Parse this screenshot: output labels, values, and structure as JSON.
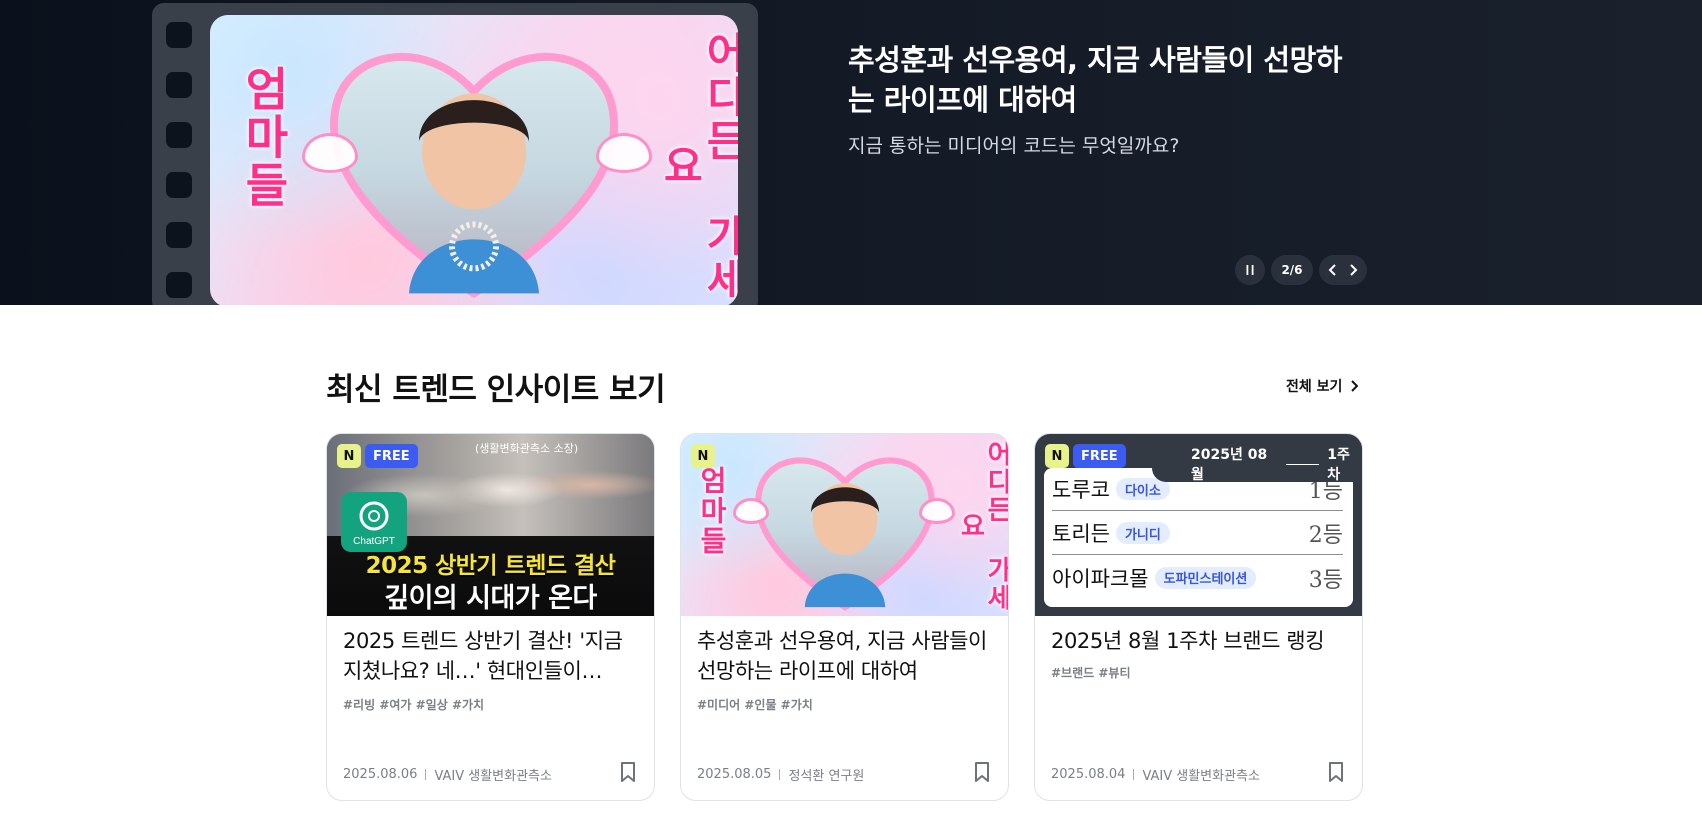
{
  "hero": {
    "title": "추성훈과 선우용여, 지금 사람들이 선망하는 라이프에 대하여",
    "subtitle": "지금 통하는 미디어의 코드는 무엇일까요?",
    "image_text_left": "엄마들",
    "image_text_right": "어디든 가세요",
    "counter": "2/6",
    "pause_icon": "pause-icon",
    "prev_icon": "chevron-left-icon",
    "next_icon": "chevron-right-icon"
  },
  "section": {
    "title": "최신 트렌드 인사이트 보기",
    "see_all": "전체 보기"
  },
  "cards": [
    {
      "badge_new": "N",
      "badge_free": "FREE",
      "thumb_top": "(생활변화관측소 소장)",
      "thumb_logo": "ChatGPT",
      "thumb_line1": "2025 상반기 트렌드 결산",
      "thumb_line2": "깊이의 시대가 온다",
      "title": "2025 트렌드 상반기 결산! '지금 지쳤나요? 네…' 현대인들이…",
      "tags": "#리빙 #여가 #일상 #가치",
      "date": "2025.08.06",
      "author": "VAIV 생활변화관측소"
    },
    {
      "badge_new": "N",
      "thumb_left": "엄마들",
      "thumb_right": "어디든 가세요",
      "title": "추성훈과 선우용여, 지금 사람들이 선망하는 라이프에 대하여",
      "tags": "#미디어 #인물 #가치",
      "date": "2025.08.05",
      "author": "정석환 연구원"
    },
    {
      "badge_new": "N",
      "badge_free": "FREE",
      "rank_period": "2025년 08월",
      "rank_week": "1주차",
      "ranking": [
        {
          "name": "도루코",
          "tag": "다이소",
          "rank": "1등"
        },
        {
          "name": "토리든",
          "tag": "가니디",
          "rank": "2등"
        },
        {
          "name": "아이파크몰",
          "tag": "도파민스테이션",
          "rank": "3등"
        }
      ],
      "title": "2025년 8월 1주차 브랜드 랭킹",
      "tags": "#브랜드 #뷰티",
      "date": "2025.08.04",
      "author": "VAIV 생활변화관측소"
    }
  ],
  "colors": {
    "hero_bg": "#0b111c",
    "free_badge": "#3c5bf0",
    "new_badge": "#e8f28b",
    "pink_text": "#ff2f8a"
  }
}
